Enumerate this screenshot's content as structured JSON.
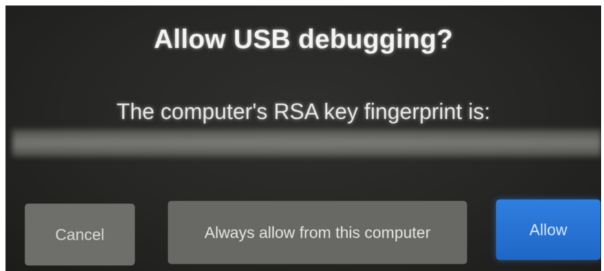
{
  "dialog": {
    "title": "Allow USB debugging?",
    "message": "The computer's RSA key fingerprint is:",
    "buttons": {
      "cancel": "Cancel",
      "always_allow": "Always allow from this computer",
      "allow": "Allow"
    }
  },
  "colors": {
    "background": "#262624",
    "secondary_button": "#6b6b67",
    "primary_button": "#2573d6",
    "text": "#f4f4f2"
  }
}
